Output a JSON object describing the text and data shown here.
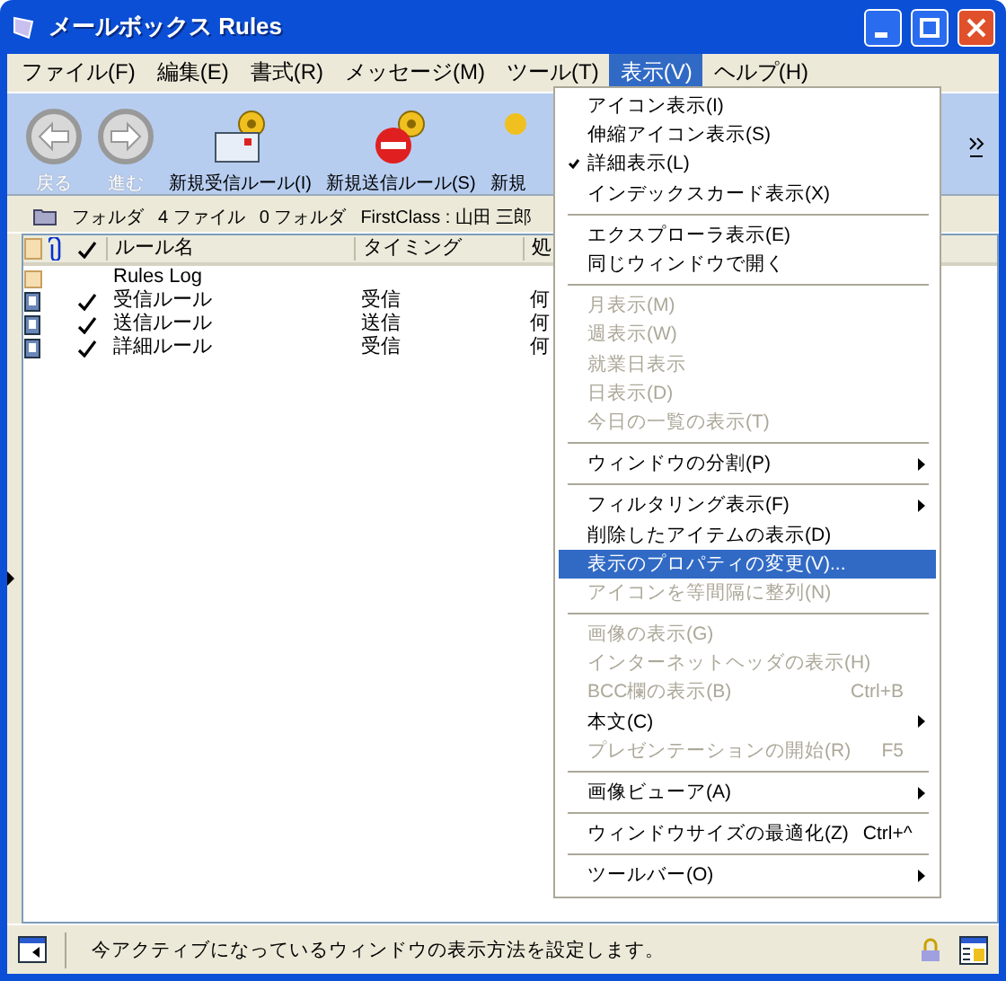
{
  "window": {
    "title": "メールボックス Rules"
  },
  "menubar": [
    {
      "label": "ファイル(F)",
      "selected": false
    },
    {
      "label": "編集(E)",
      "selected": false
    },
    {
      "label": "書式(R)",
      "selected": false
    },
    {
      "label": "メッセージ(M)",
      "selected": false
    },
    {
      "label": "ツール(T)",
      "selected": false
    },
    {
      "label": "表示(V)",
      "selected": true
    },
    {
      "label": "ヘルプ(H)",
      "selected": false
    }
  ],
  "toolbar": [
    {
      "kind": "back",
      "label": "戻る",
      "disabled": true
    },
    {
      "kind": "forward",
      "label": "進む",
      "disabled": true
    },
    {
      "kind": "incoming",
      "label": "新規受信ルール(I)",
      "disabled": false
    },
    {
      "kind": "outgoing",
      "label": "新規送信ルール(S)",
      "disabled": false
    },
    {
      "kind": "other",
      "label": "新規",
      "disabled": false
    }
  ],
  "folder_bar": {
    "label": "フォルダ",
    "files": "4 ファイル",
    "folders": "0 フォルダ",
    "account": "FirstClass : 山田 三郎"
  },
  "table": {
    "columns": [
      "ルール名",
      "タイミング",
      "処"
    ],
    "rows": [
      {
        "kind": "folder",
        "checked": false,
        "cells": [
          "Rules Log",
          "",
          ""
        ]
      },
      {
        "kind": "rule",
        "checked": true,
        "cells": [
          "受信ルール",
          "受信",
          "何"
        ]
      },
      {
        "kind": "rule",
        "checked": true,
        "cells": [
          "送信ルール",
          "送信",
          "何"
        ]
      },
      {
        "kind": "rule",
        "checked": true,
        "cells": [
          "詳細ルール",
          "受信",
          "何"
        ]
      }
    ]
  },
  "menu": [
    {
      "kind": "item",
      "label": "アイコン表示(I)",
      "checked": false,
      "disabled": false,
      "selected": false,
      "submenu": false
    },
    {
      "kind": "item",
      "label": "伸縮アイコン表示(S)",
      "checked": false,
      "disabled": false,
      "selected": false,
      "submenu": false
    },
    {
      "kind": "item",
      "label": "詳細表示(L)",
      "checked": true,
      "disabled": false,
      "selected": false,
      "submenu": false
    },
    {
      "kind": "item",
      "label": "インデックスカード表示(X)",
      "checked": false,
      "disabled": false,
      "selected": false,
      "submenu": false
    },
    {
      "kind": "separator"
    },
    {
      "kind": "item",
      "label": "エクスプローラ表示(E)",
      "checked": false,
      "disabled": false,
      "selected": false,
      "submenu": false
    },
    {
      "kind": "item",
      "label": "同じウィンドウで開く",
      "checked": false,
      "disabled": false,
      "selected": false,
      "submenu": false
    },
    {
      "kind": "separator"
    },
    {
      "kind": "item",
      "label": "月表示(M)",
      "checked": false,
      "disabled": true,
      "selected": false,
      "submenu": false
    },
    {
      "kind": "item",
      "label": "週表示(W)",
      "checked": false,
      "disabled": true,
      "selected": false,
      "submenu": false
    },
    {
      "kind": "item",
      "label": "就業日表示",
      "checked": false,
      "disabled": true,
      "selected": false,
      "submenu": false
    },
    {
      "kind": "item",
      "label": "日表示(D)",
      "checked": false,
      "disabled": true,
      "selected": false,
      "submenu": false
    },
    {
      "kind": "item",
      "label": "今日の一覧の表示(T)",
      "checked": false,
      "disabled": true,
      "selected": false,
      "submenu": false
    },
    {
      "kind": "separator"
    },
    {
      "kind": "item",
      "label": "ウィンドウの分割(P)",
      "checked": false,
      "disabled": false,
      "selected": false,
      "submenu": true
    },
    {
      "kind": "separator"
    },
    {
      "kind": "item",
      "label": "フィルタリング表示(F)",
      "checked": false,
      "disabled": false,
      "selected": false,
      "submenu": true
    },
    {
      "kind": "item",
      "label": "削除したアイテムの表示(D)",
      "checked": false,
      "disabled": false,
      "selected": false,
      "submenu": false
    },
    {
      "kind": "item",
      "label": "表示のプロパティの変更(V)...",
      "checked": false,
      "disabled": false,
      "selected": true,
      "submenu": false
    },
    {
      "kind": "item",
      "label": "アイコンを等間隔に整列(N)",
      "checked": false,
      "disabled": true,
      "selected": false,
      "submenu": false
    },
    {
      "kind": "separator"
    },
    {
      "kind": "item",
      "label": "画像の表示(G)",
      "checked": false,
      "disabled": true,
      "selected": false,
      "submenu": false
    },
    {
      "kind": "item",
      "label": "インターネットヘッダの表示(H)",
      "checked": false,
      "disabled": true,
      "selected": false,
      "submenu": false
    },
    {
      "kind": "item",
      "label": "BCC欄の表示(B)",
      "shortcut": "Ctrl+B",
      "checked": false,
      "disabled": true,
      "selected": false,
      "submenu": false
    },
    {
      "kind": "item",
      "label": "本文(C)",
      "checked": false,
      "disabled": false,
      "selected": false,
      "submenu": true
    },
    {
      "kind": "item",
      "label": "プレゼンテーションの開始(R)",
      "shortcut": "F5",
      "checked": false,
      "disabled": true,
      "selected": false,
      "submenu": false
    },
    {
      "kind": "separator"
    },
    {
      "kind": "item",
      "label": "画像ビューア(A)",
      "checked": false,
      "disabled": false,
      "selected": false,
      "submenu": true
    },
    {
      "kind": "separator"
    },
    {
      "kind": "item",
      "label": "ウィンドウサイズの最適化(Z)",
      "shortcut": "Ctrl+^",
      "checked": false,
      "disabled": false,
      "selected": false,
      "submenu": false
    },
    {
      "kind": "separator"
    },
    {
      "kind": "item",
      "label": "ツールバー(O)",
      "checked": false,
      "disabled": false,
      "selected": false,
      "submenu": true
    }
  ],
  "status_bar": {
    "text": "今アクティブになっているウィンドウの表示方法を設定します。"
  }
}
